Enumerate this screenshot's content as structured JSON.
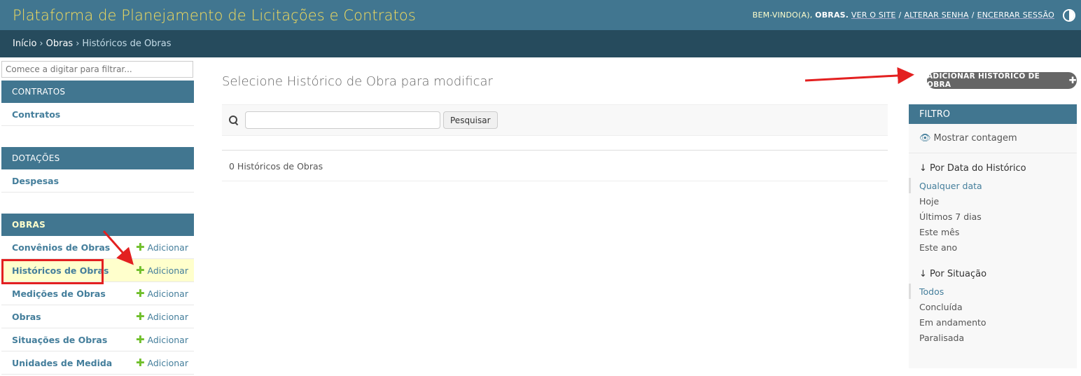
{
  "header": {
    "site_name": "Plataforma de Planejamento de Licitações e Contratos",
    "welcome": "BEM-VINDO(A),",
    "user": "OBRAS.",
    "links": [
      "VER O SITE",
      "ALTERAR SENHA",
      "ENCERRAR SESSÃO"
    ],
    "sep": "/"
  },
  "breadcrumbs": {
    "home": "Início",
    "app": "Obras",
    "current": "Históricos de Obras",
    "sep": "›"
  },
  "sidebar": {
    "filter_placeholder": "Comece a digitar para filtrar...",
    "add_label": "Adicionar",
    "modules": [
      {
        "caption": "CONTRATOS",
        "items": [
          {
            "label": "Contratos"
          }
        ]
      },
      {
        "caption": "DOTAÇÕES",
        "items": [
          {
            "label": "Despesas"
          }
        ]
      },
      {
        "caption": "OBRAS",
        "items": [
          {
            "label": "Convênios de Obras"
          },
          {
            "label": "Históricos de Obras"
          },
          {
            "label": "Medições de Obras"
          },
          {
            "label": "Obras"
          },
          {
            "label": "Situações de Obras"
          },
          {
            "label": "Unidades de Medida"
          }
        ]
      }
    ]
  },
  "content": {
    "title": "Selecione Histórico de Obra para modificar",
    "add_button": "ADICIONAR HISTÓRICO DE OBRA",
    "search_button": "Pesquisar",
    "result_count": "0 Históricos de Obras"
  },
  "filter": {
    "title": "FILTRO",
    "show_counts": "Mostrar contagem",
    "groups": [
      {
        "heading": "↓ Por Data do Histórico",
        "options": [
          "Qualquer data",
          "Hoje",
          "Últimos 7 dias",
          "Este mês",
          "Este ano"
        ]
      },
      {
        "heading": "↓ Por Situação",
        "options": [
          "Todos",
          "Concluída",
          "Em andamento",
          "Paralisada"
        ]
      }
    ]
  },
  "colors": {
    "header_bg": "#417690",
    "breadcrumb_bg": "#264b5d",
    "site_name": "#f5dd5d",
    "link": "#447e9b",
    "add_plus": "#70bf2b",
    "current_row_bg": "#ffffcc",
    "annotation": "#e32020"
  }
}
